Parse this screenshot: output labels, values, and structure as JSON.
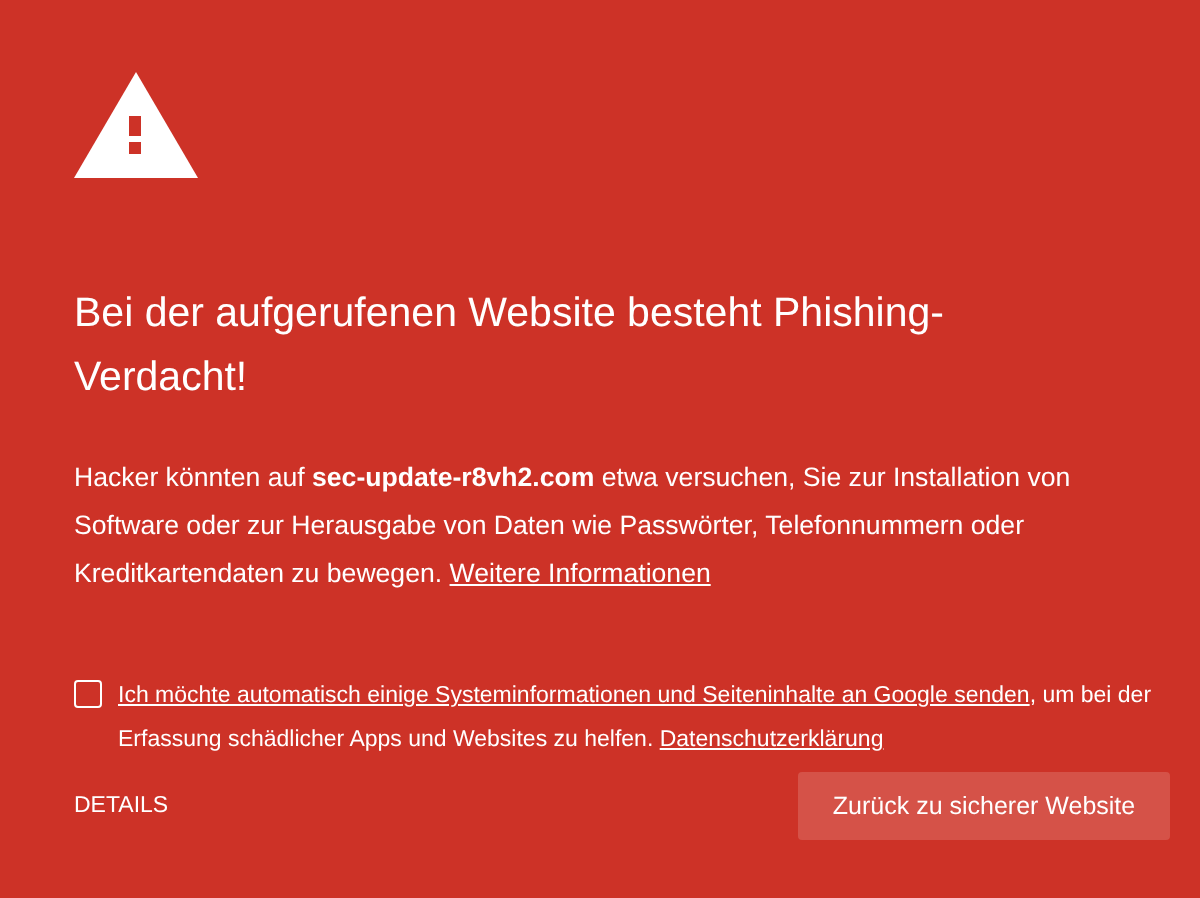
{
  "title": "Bei der aufgerufenen Website besteht Phishing-Verdacht!",
  "body": {
    "text": "Hacker könnten auf **sec-update-r8vh2.com** etwa versuchen, Sie zur Installation von Software oder zur Herausgabe von Daten wie Passwörter, Telefonnummern oder Kreditkartendaten zu bewegen.",
    "link": "Weitere Informationen"
  },
  "consent": {
    "checked": false,
    "parts": [
      {
        "kind": "link",
        "text": "Ich möchte automatisch einige Systeminformationen und Seiteninhalte an Google senden"
      },
      {
        "kind": "text",
        "text": ", um bei der Erfassung schädlicher Apps und Websites zu helfen."
      },
      {
        "kind": "link",
        "text": "Datenschutzerklärung"
      }
    ]
  },
  "details_button": "DETAILS",
  "back_button": "Zurück zu sicherer Website"
}
